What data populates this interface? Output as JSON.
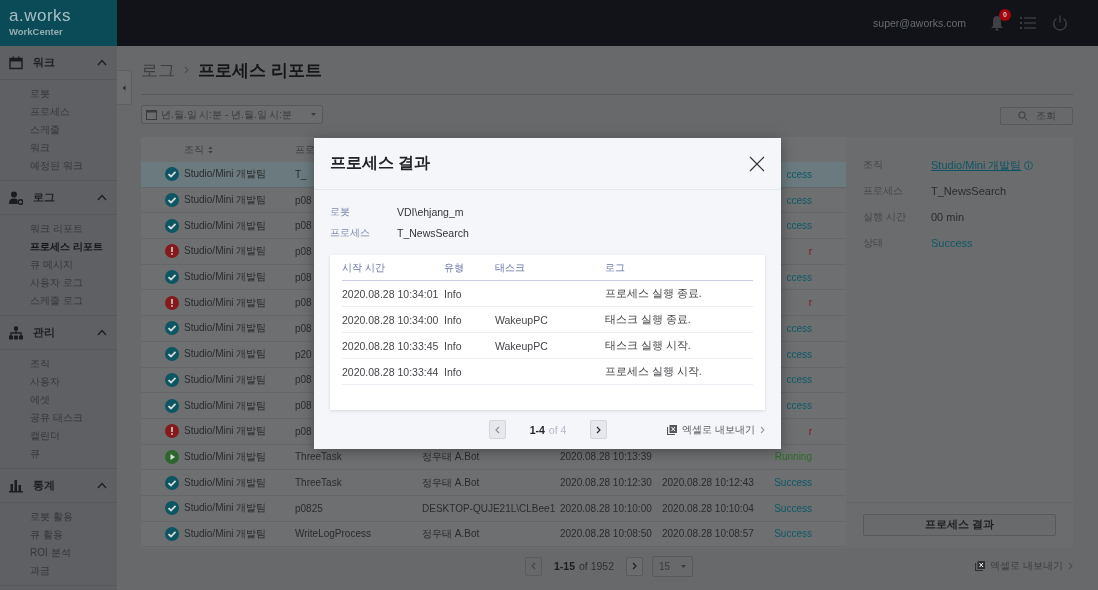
{
  "header": {
    "logo": "a.works",
    "product": "WorkCenter",
    "user": "super@aworks.com",
    "notification_count": "0"
  },
  "sidebar": {
    "sections": [
      {
        "title": "워크",
        "expanded": true,
        "items": [
          {
            "label": "로봇",
            "selected": false
          },
          {
            "label": "프로세스",
            "selected": false
          },
          {
            "label": "스케줄",
            "selected": false
          },
          {
            "label": "워크",
            "selected": false
          },
          {
            "label": "예정된 워크",
            "selected": false
          }
        ]
      },
      {
        "title": "로그",
        "expanded": true,
        "items": [
          {
            "label": "워크 리포트",
            "selected": false
          },
          {
            "label": "프로세스 리포트",
            "selected": true
          },
          {
            "label": "큐 메시지",
            "selected": false
          },
          {
            "label": "사용자 로그",
            "selected": false
          },
          {
            "label": "스케줄 로그",
            "selected": false
          }
        ]
      },
      {
        "title": "관리",
        "expanded": true,
        "items": [
          {
            "label": "조직",
            "selected": false
          },
          {
            "label": "사용자",
            "selected": false
          },
          {
            "label": "에셋",
            "selected": false
          },
          {
            "label": "공유 태스크",
            "selected": false
          },
          {
            "label": "캘린더",
            "selected": false
          },
          {
            "label": "큐",
            "selected": false
          }
        ]
      },
      {
        "title": "통계",
        "expanded": true,
        "items": [
          {
            "label": "로봇 활용",
            "selected": false
          },
          {
            "label": "큐 활용",
            "selected": false
          },
          {
            "label": "ROI 분석",
            "selected": false
          },
          {
            "label": "과금",
            "selected": false
          }
        ]
      }
    ]
  },
  "breadcrumb": {
    "parent": "로그",
    "current": "프로세스 리포트"
  },
  "date_filter": {
    "placeholder": "년.월.일 시:분 - 년.월.일 시:분"
  },
  "search_button": "조회",
  "table": {
    "columns": [
      "조직",
      "프로"
    ],
    "rows": [
      {
        "kind": "success",
        "selected": true,
        "org": "Studio/Mini 개발팀",
        "process": "T_",
        "status": "ccess"
      },
      {
        "kind": "success",
        "selected": false,
        "org": "Studio/Mini 개발팀",
        "process": "p08",
        "status": "ccess"
      },
      {
        "kind": "success",
        "selected": false,
        "org": "Studio/Mini 개발팀",
        "process": "p08",
        "status": "ccess"
      },
      {
        "kind": "error",
        "selected": false,
        "org": "Studio/Mini 개발팀",
        "process": "p08",
        "status": "r"
      },
      {
        "kind": "success",
        "selected": false,
        "org": "Studio/Mini 개발팀",
        "process": "p08",
        "status": "ccess"
      },
      {
        "kind": "error",
        "selected": false,
        "org": "Studio/Mini 개발팀",
        "process": "p08",
        "status": "r"
      },
      {
        "kind": "success",
        "selected": false,
        "org": "Studio/Mini 개발팀",
        "process": "p08",
        "status": "ccess"
      },
      {
        "kind": "success",
        "selected": false,
        "org": "Studio/Mini 개발팀",
        "process": "p20",
        "status": "ccess"
      },
      {
        "kind": "success",
        "selected": false,
        "org": "Studio/Mini 개발팀",
        "process": "p08",
        "status": "ccess"
      },
      {
        "kind": "success",
        "selected": false,
        "org": "Studio/Mini 개발팀",
        "process": "p08",
        "status": "ccess"
      },
      {
        "kind": "error",
        "selected": false,
        "org": "Studio/Mini 개발팀",
        "process": "p08",
        "status": "r"
      },
      {
        "kind": "running",
        "selected": false,
        "org": "Studio/Mini 개발팀",
        "process": "ThreeTask",
        "robot": "정우태 A.Bot",
        "start": "2020.08.28 10:13:39",
        "status": "Running"
      },
      {
        "kind": "success",
        "selected": false,
        "org": "Studio/Mini 개발팀",
        "process": "ThreeTask",
        "robot": "정우태 A.Bot",
        "start": "2020.08.28 10:12:30",
        "end": "2020.08.28 10:12:43",
        "status": "Success"
      },
      {
        "kind": "success",
        "selected": false,
        "org": "Studio/Mini 개발팀",
        "process": "p0825",
        "robot": "DESKTOP-QUJE21L\\CLBee1",
        "start": "2020.08.28 10:10:00",
        "end": "2020.08.28 10:10:04",
        "status": "Success"
      },
      {
        "kind": "success",
        "selected": false,
        "org": "Studio/Mini 개발팀",
        "process": "WriteLogProcess",
        "robot": "정우태 A.Bot",
        "start": "2020.08.28 10:08:50",
        "end": "2020.08.28 10:08:57",
        "status": "Success"
      }
    ]
  },
  "details": {
    "fields": [
      {
        "kind": "link",
        "label": "조직",
        "value": "Studio/Mini 개발팀"
      },
      {
        "kind": "text",
        "label": "프로세스",
        "value": "T_NewsSearch"
      },
      {
        "kind": "text",
        "label": "실행 시간",
        "value": "00 min"
      },
      {
        "kind": "status",
        "label": "상태",
        "value": "Success"
      }
    ],
    "button": "프로세스 결과"
  },
  "pagination": {
    "range": "1-15",
    "total": "of 1952",
    "page_size": "15"
  },
  "export": "엑셀로 내보내기",
  "modal": {
    "title": "프로세스 결과",
    "fields": [
      {
        "label": "로봇",
        "value": "VDI\\ehjang_m"
      },
      {
        "label": "프로세스",
        "value": "T_NewsSearch"
      }
    ],
    "log_table": {
      "columns": [
        "시작 시간",
        "유형",
        "태스크",
        "로그"
      ],
      "rows": [
        {
          "time": "2020.08.28 10:34:01",
          "type": "Info",
          "message": "프로세스 실행 종료."
        },
        {
          "time": "2020.08.28 10:34:00",
          "type": "Info",
          "task": "WakeupPC",
          "message": "태스크 실행 종료."
        },
        {
          "time": "2020.08.28 10:33:45",
          "type": "Info",
          "task": "WakeupPC",
          "message": "태스크 실행 시작."
        },
        {
          "time": "2020.08.28 10:33:44",
          "type": "Info",
          "message": "프로세스 실행 시작."
        }
      ]
    },
    "pagination": {
      "range": "1-4",
      "total": "of 4"
    },
    "export": "엑셀로 내보내기"
  }
}
